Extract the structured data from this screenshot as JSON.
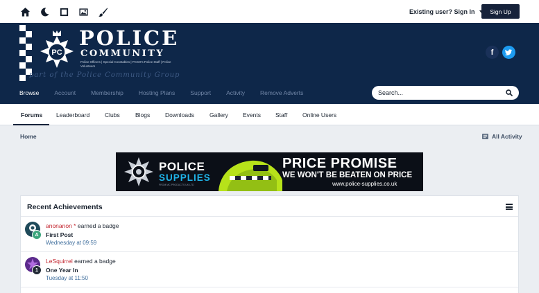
{
  "userbar": {
    "tools": [
      "home-icon",
      "moon-icon",
      "square-icon",
      "image-icon",
      "brush-icon"
    ],
    "signin_label": "Existing user? Sign In",
    "signup_label": "Sign Up"
  },
  "header": {
    "logo_title": "POLICE",
    "logo_subtitle": "COMMUNITY",
    "logo_lines": "Police Officers | Special Constables | PCSO's Police Staff | Police Volunteers",
    "logo_tagline": "part of the Police Community Group",
    "logo_badge": "PC"
  },
  "social": {
    "facebook": "f",
    "twitter": "twitter-icon"
  },
  "mainnav": {
    "items": [
      {
        "label": "Browse",
        "active": true
      },
      {
        "label": "Account"
      },
      {
        "label": "Membership"
      },
      {
        "label": "Hosting Plans"
      },
      {
        "label": "Support"
      },
      {
        "label": "Activity"
      },
      {
        "label": "Remove Adverts"
      }
    ]
  },
  "search": {
    "placeholder": "Search..."
  },
  "subnav": {
    "items": [
      "Forums",
      "Leaderboard",
      "Clubs",
      "Blogs",
      "Downloads",
      "Gallery",
      "Events",
      "Staff",
      "Online Users"
    ]
  },
  "breadcrumb": {
    "home": "Home",
    "all_activity": "All Activity"
  },
  "ad": {
    "brand_top": "POLICE",
    "brand_bottom": "SUPPLIES",
    "brand_small": "FROM MC PRODUCTS UK LTD",
    "headline": "PRICE PROMISE",
    "subline": "WE WON'T BE BEATEN ON PRICE",
    "url": "www.police-supplies.co.uk"
  },
  "achievements": {
    "title": "Recent Achievements",
    "items": [
      {
        "user": "anonanon *",
        "action": "earned a badge",
        "badge": "First Post",
        "time": "Wednesday at 09:59",
        "avatar_color": "#1f4a5a",
        "badge_letter": "A",
        "badge_color": "#3ba57c"
      },
      {
        "user": "LeSquirrel",
        "action": "earned a badge",
        "badge": "One Year In",
        "time": "Tuesday at 11:50",
        "avatar_color": "#5b2a8c",
        "badge_letter": "1",
        "badge_color": "#222a36"
      }
    ]
  },
  "colors": {
    "header_bg": "#0e2749",
    "accent": "#16223a",
    "user_link": "#c2222c",
    "time_link": "#3e6d9c"
  }
}
